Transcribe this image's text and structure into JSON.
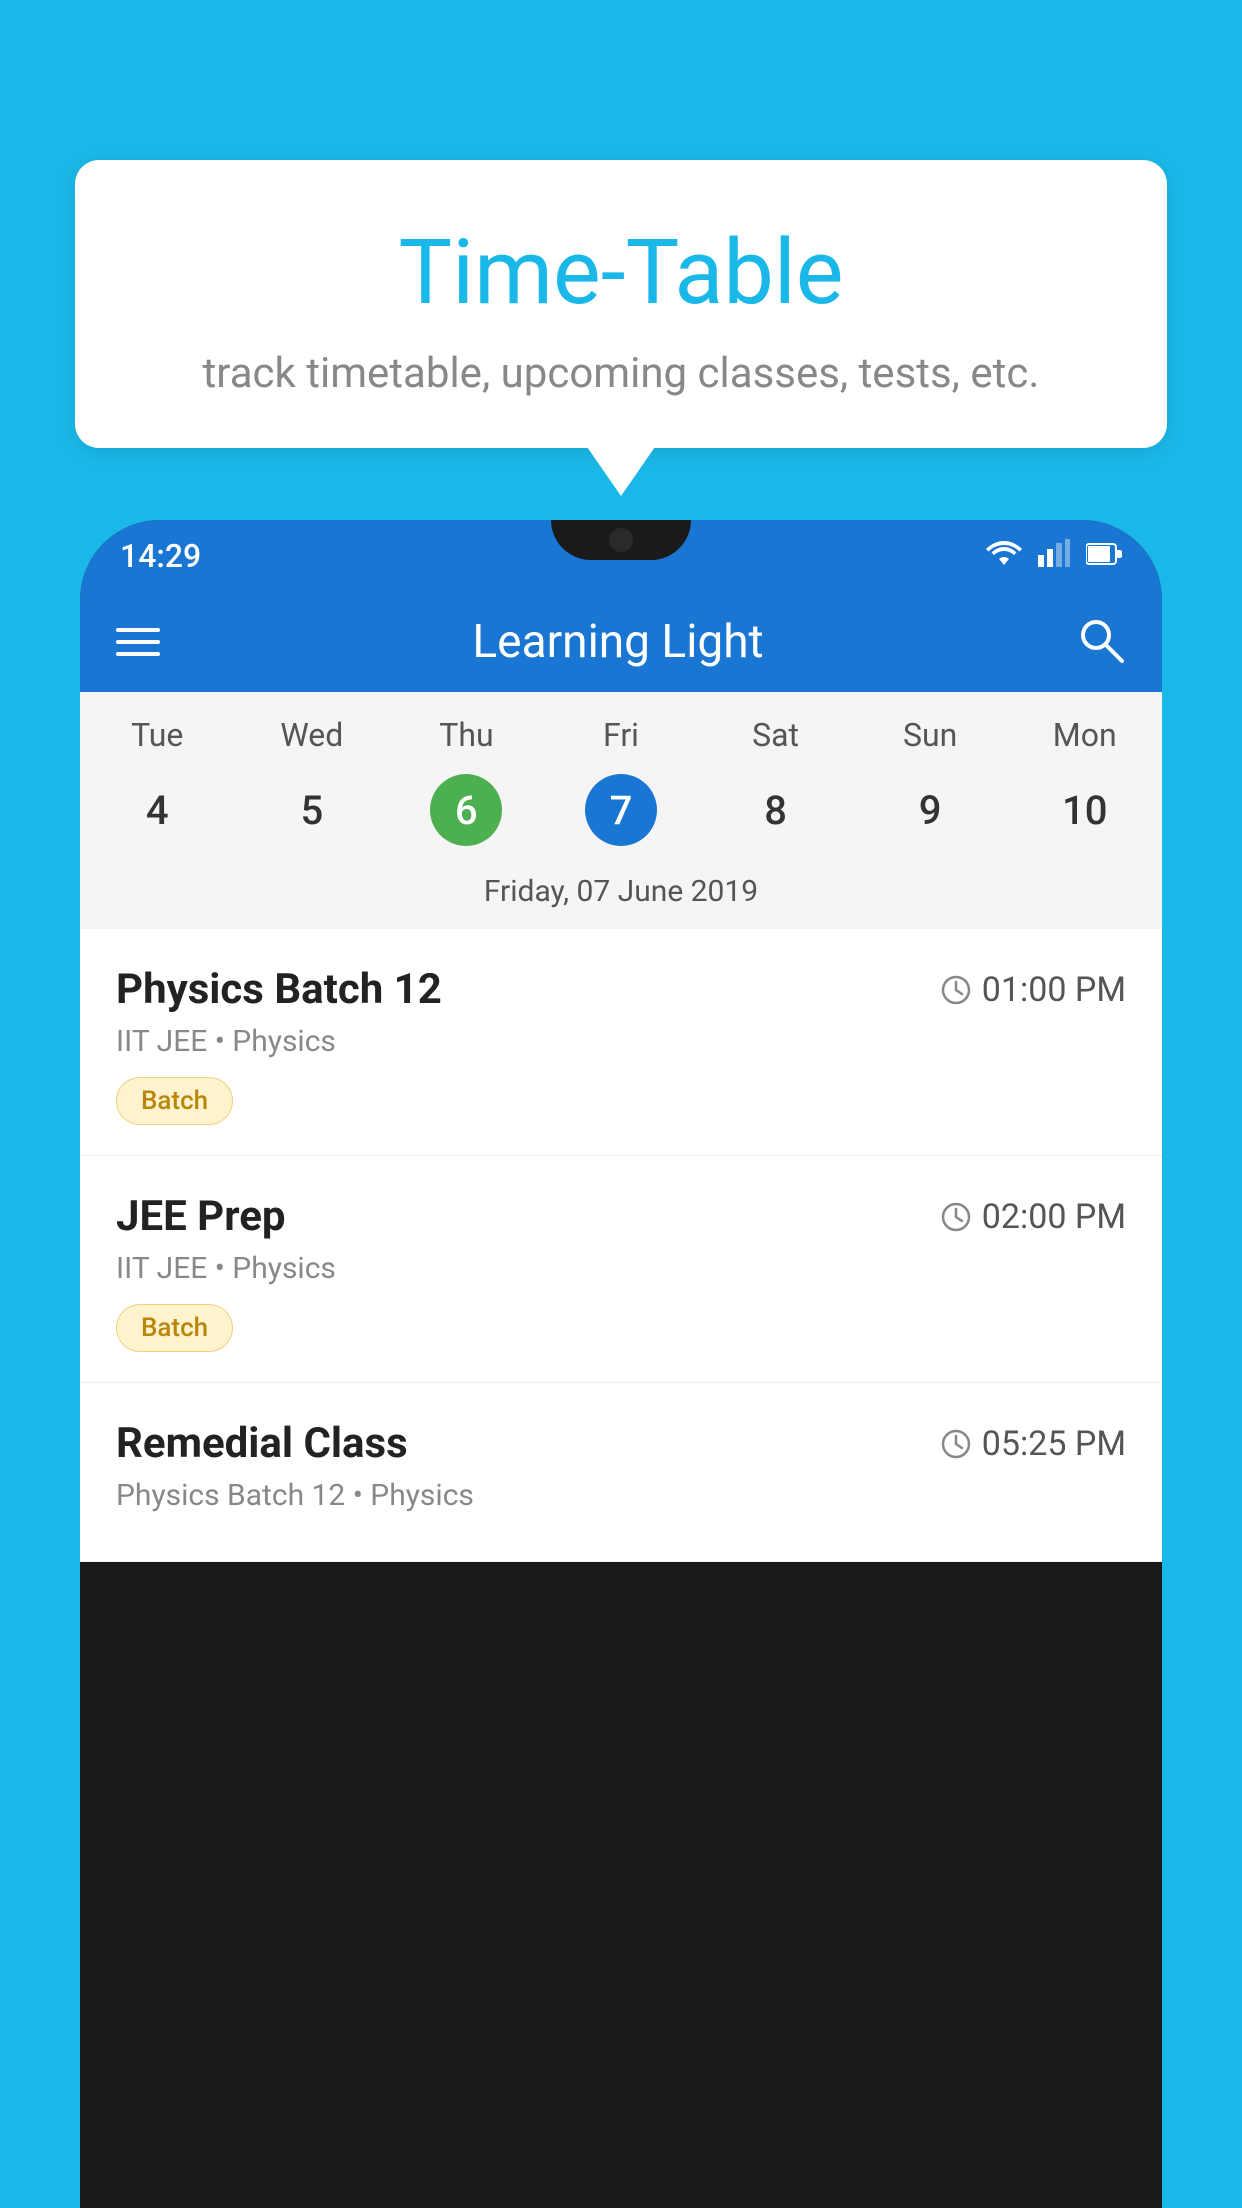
{
  "background_color": "#1ab8e8",
  "bubble": {
    "title": "Time-Table",
    "subtitle": "track timetable, upcoming classes, tests, etc."
  },
  "phone": {
    "status_bar": {
      "time": "14:29"
    },
    "app_bar": {
      "title": "Learning Light"
    },
    "calendar": {
      "days": [
        "Tue",
        "Wed",
        "Thu",
        "Fri",
        "Sat",
        "Sun",
        "Mon"
      ],
      "dates": [
        "4",
        "5",
        "6",
        "7",
        "8",
        "9",
        "10"
      ],
      "today_index": 2,
      "selected_index": 3,
      "selected_date_label": "Friday, 07 June 2019"
    },
    "schedule": [
      {
        "title": "Physics Batch 12",
        "time": "01:00 PM",
        "subtitle": "IIT JEE • Physics",
        "badge": "Batch"
      },
      {
        "title": "JEE Prep",
        "time": "02:00 PM",
        "subtitle": "IIT JEE • Physics",
        "badge": "Batch"
      },
      {
        "title": "Remedial Class",
        "time": "05:25 PM",
        "subtitle": "Physics Batch 12 • Physics",
        "badge": null
      }
    ]
  }
}
